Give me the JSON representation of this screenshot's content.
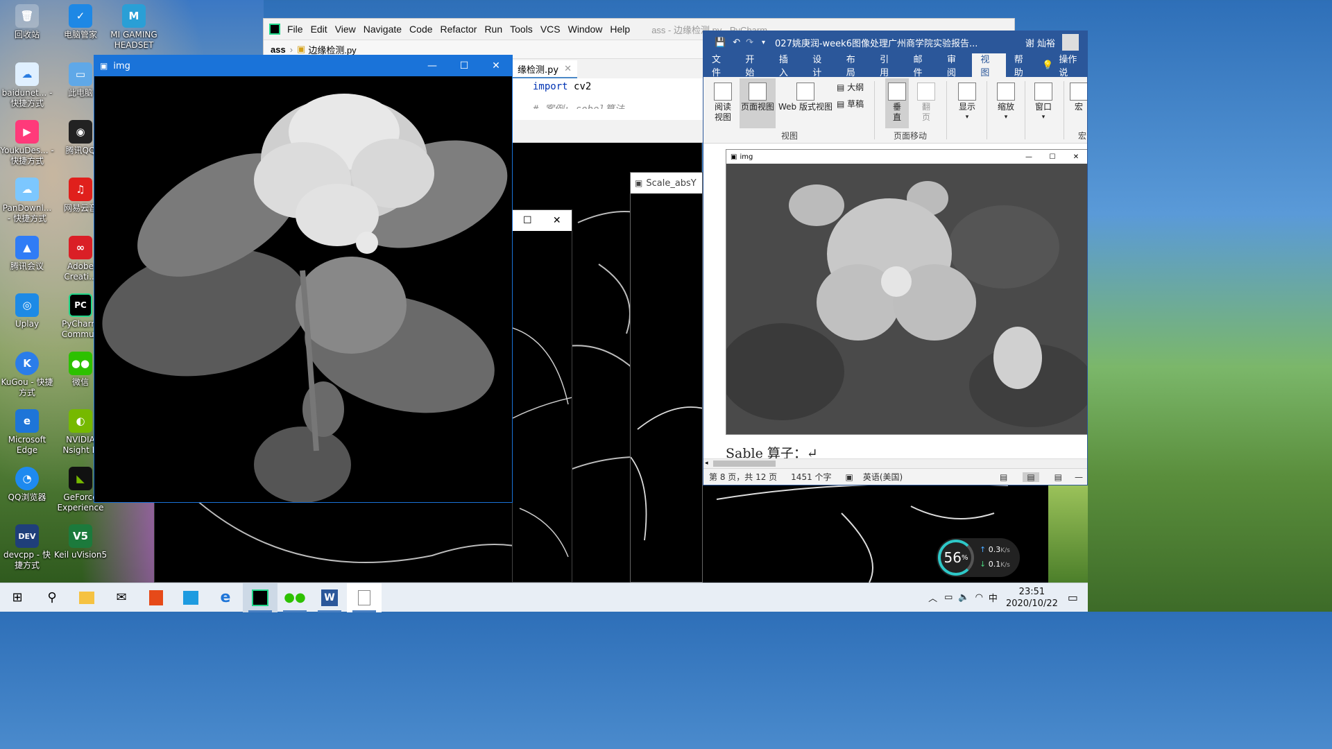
{
  "desktop": {
    "icons": [
      {
        "label": "回收站"
      },
      {
        "label": "电脑管家"
      },
      {
        "label": "MI GAMING HEADSET"
      },
      {
        "label": "baidunet... - 快捷方式"
      },
      {
        "label": "此电脑"
      },
      {
        "label": "YoukuDes... - 快捷方式"
      },
      {
        "label": "腾讯QQ"
      },
      {
        "label": "PanDownl... - 快捷方式"
      },
      {
        "label": "网易云音"
      },
      {
        "label": "腾讯会议"
      },
      {
        "label": "Adobe Creati..."
      },
      {
        "label": "Uplay"
      },
      {
        "label": "PyCharm Commun"
      },
      {
        "label": "KuGou - 快捷方式"
      },
      {
        "label": "微信"
      },
      {
        "label": "Microsoft Edge"
      },
      {
        "label": "NVIDIA Nsight H"
      },
      {
        "label": "QQ浏览器"
      },
      {
        "label": "GeForce Experience"
      },
      {
        "label": "devcpp - 快捷方式"
      },
      {
        "label": "Keil uVision5"
      }
    ]
  },
  "pycharm": {
    "window_title": "ass - 边缘检测.py - PyCharm",
    "menu": [
      "File",
      "Edit",
      "View",
      "Navigate",
      "Code",
      "Refactor",
      "Run",
      "Tools",
      "VCS",
      "Window",
      "Help"
    ],
    "breadcrumb_project": "ass",
    "breadcrumb_file": "边缘检测.py",
    "editor_tab": "缘检测.py",
    "code_line1_kw": "import",
    "code_line1_mod": "cv2",
    "code_line2": "# 案例: sobel算法"
  },
  "img_window": {
    "title": "img"
  },
  "scale_window": {
    "title": "Scale_absY"
  },
  "word": {
    "doc_title": "027姚庚润-week6图像处理广州商学院实验报告...",
    "user": "谢 灿裕",
    "tabs": [
      "文件",
      "开始",
      "插入",
      "设计",
      "布局",
      "引用",
      "邮件",
      "审阅",
      "视图",
      "帮助",
      "操作说"
    ],
    "active_tab": "视图",
    "ribbon": {
      "read_view": "阅读视图",
      "page_view": "页面视图",
      "web_view": "Web 版式视图",
      "outline": "大纲",
      "draft": "草稿",
      "group_views": "视图",
      "vertical": "垂直",
      "side": "翻页",
      "group_move": "页面移动",
      "show": "显示",
      "zoom": "缩放",
      "window": "窗口",
      "macro": "宏",
      "macro_group": "宏"
    },
    "embedded_img_title": "img",
    "doc_text": "Sable 算子：↵",
    "status": {
      "page": "第 8 页，共 12 页",
      "words": "1451 个字",
      "lang": "英语(美国)"
    }
  },
  "net_widget": {
    "percent": "56",
    "up": "0.3",
    "down": "0.1",
    "unit": "K/s"
  },
  "taskbar": {
    "time": "23:51",
    "date": "2020/10/22",
    "ime": "中"
  }
}
